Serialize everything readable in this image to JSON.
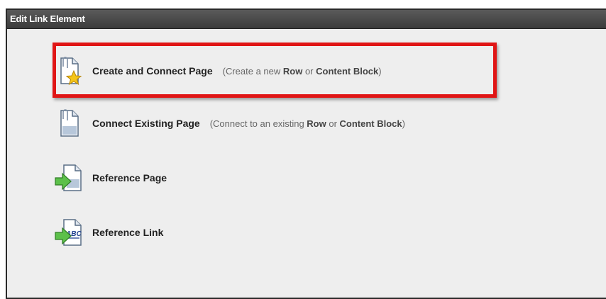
{
  "window": {
    "title": "Edit Link Element"
  },
  "options": [
    {
      "label": "Create and Connect Page",
      "desc_prefix": "(Create a new ",
      "desc_row": "Row",
      "desc_or": " or ",
      "desc_block": "Content Block",
      "desc_suffix": ")",
      "icon": "document-star-icon"
    },
    {
      "label": "Connect Existing Page",
      "desc_prefix": "(Connect to an existing ",
      "desc_row": "Row",
      "desc_or": " or ",
      "desc_block": "Content Block",
      "desc_suffix": ")",
      "icon": "document-clip-icon"
    },
    {
      "label": "Reference Page",
      "icon": "document-arrow-icon"
    },
    {
      "label": "Reference Link",
      "icon": "abc-document-arrow-icon"
    }
  ],
  "colors": {
    "highlight": "#e01515",
    "titlebar": "#3c3c3c",
    "background": "#eeeeee"
  }
}
